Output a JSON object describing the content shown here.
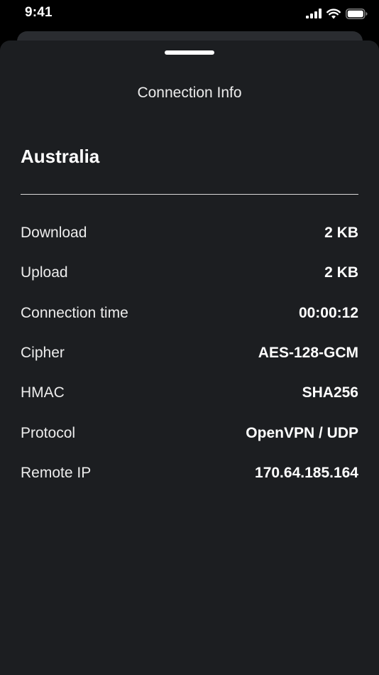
{
  "status_bar": {
    "time": "9:41",
    "icons": [
      "cellular-signal-icon",
      "wifi-icon",
      "battery-icon"
    ]
  },
  "sheet": {
    "title": "Connection Info",
    "country": "Australia",
    "rows": [
      {
        "label": "Download",
        "value": "2 KB"
      },
      {
        "label": "Upload",
        "value": "2 KB"
      },
      {
        "label": "Connection time",
        "value": "00:00:12"
      },
      {
        "label": "Cipher",
        "value": "AES-128-GCM"
      },
      {
        "label": "HMAC",
        "value": "SHA256"
      },
      {
        "label": "Protocol",
        "value": "OpenVPN / UDP"
      },
      {
        "label": "Remote IP",
        "value": "170.64.185.164"
      }
    ]
  },
  "colors": {
    "background": "#000000",
    "sheet": "#1c1e21",
    "text": "#ffffff"
  }
}
